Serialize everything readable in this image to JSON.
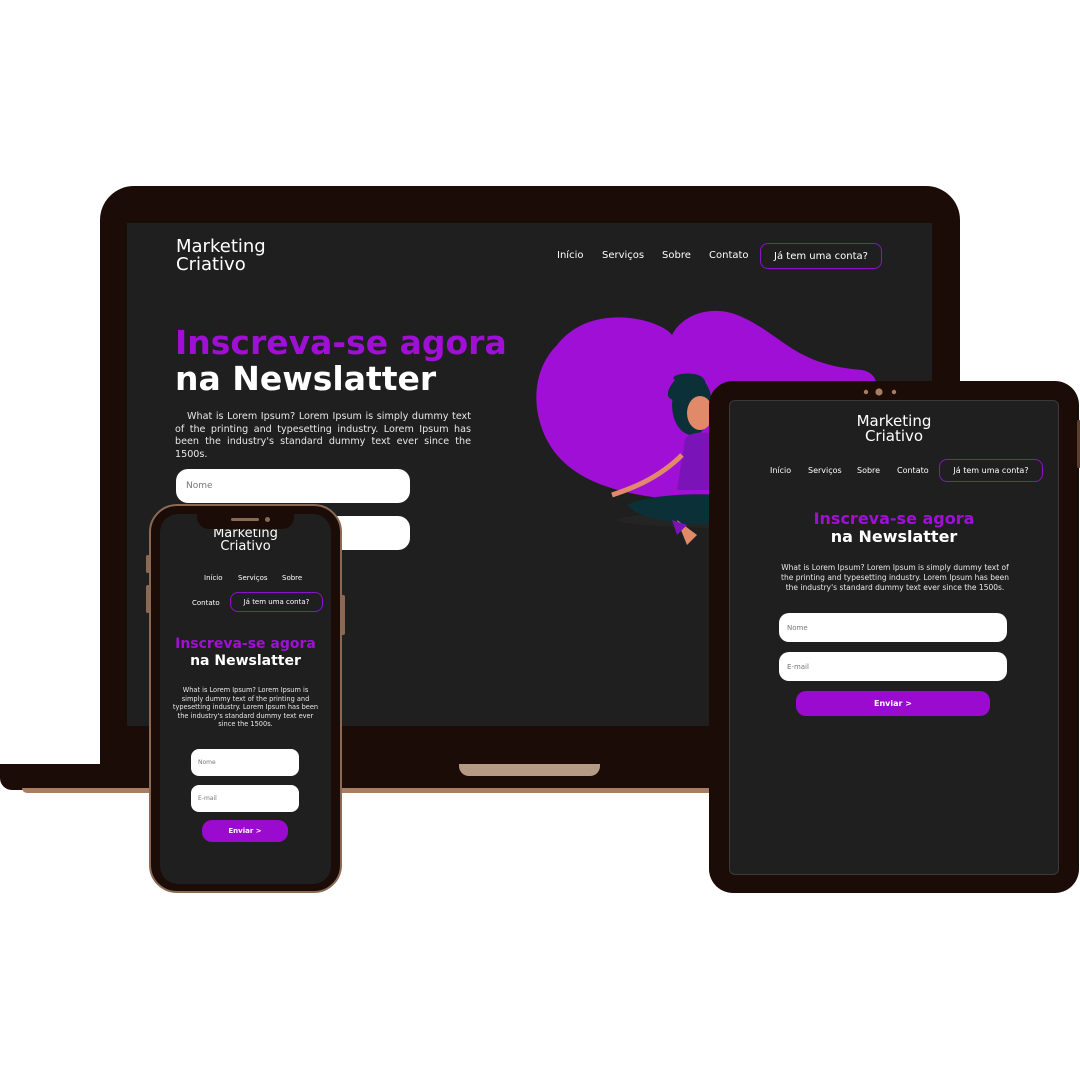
{
  "brand": {
    "line1": "Marketing",
    "line2": "Criativo"
  },
  "nav": {
    "inicio": "Início",
    "servicos": "Serviços",
    "sobre": "Sobre",
    "contato": "Contato",
    "account": "Já tem uma conta?"
  },
  "hero": {
    "title_line1": "Inscreva-se agora",
    "title_line2": "na Newslatter",
    "body": "What is Lorem Ipsum? Lorem Ipsum is simply dummy text of the printing and typesetting industry. Lorem Ipsum has been the industry's standard dummy text ever since the 1500s."
  },
  "form": {
    "name_placeholder": "Nome",
    "email_placeholder": "E-mail",
    "submit_label": "Enviar >"
  },
  "colors": {
    "accent": "#a00fd6",
    "background": "#1f1f1f",
    "device_frame": "#1c0c07"
  }
}
